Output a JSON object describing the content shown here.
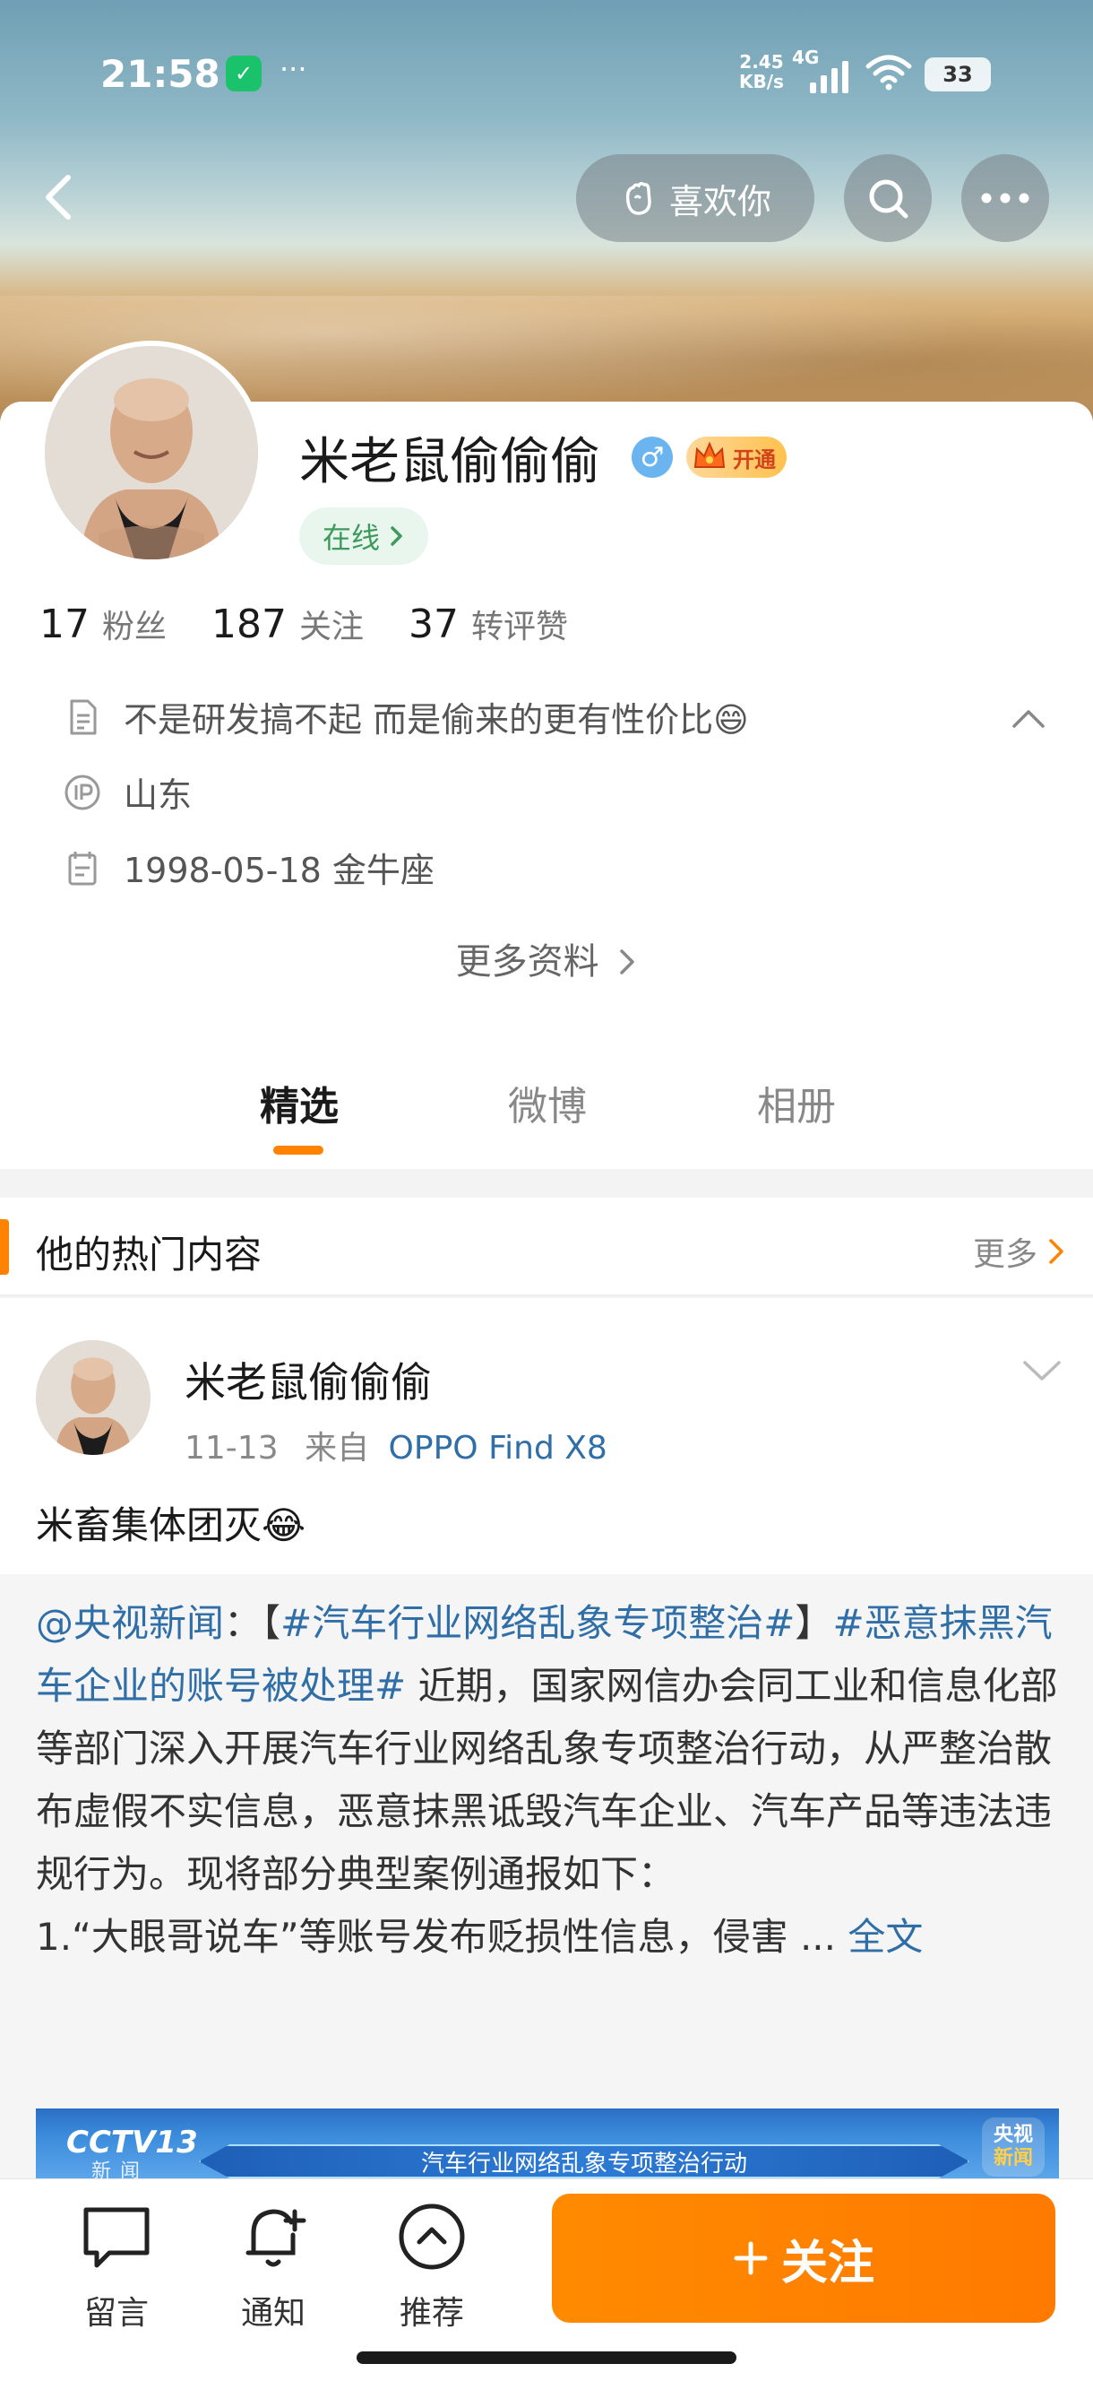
{
  "status_bar": {
    "time": "21:58",
    "app_badge": "✓",
    "dots": "···",
    "speed_value": "2.45",
    "speed_unit": "KB/s",
    "network": "4G",
    "battery": "33"
  },
  "header": {
    "like_label": "喜欢你"
  },
  "profile": {
    "name": "米老鼠偷偷偷",
    "gender_symbol": "♂",
    "vip_label": "开通",
    "online_label": "在线",
    "stats": [
      {
        "num": "17",
        "label": "粉丝"
      },
      {
        "num": "187",
        "label": "关注"
      },
      {
        "num": "37",
        "label": "转评赞"
      }
    ],
    "bio": "不是研发搞不起 而是偷来的更有性价比😄",
    "location": "山东",
    "birthday": "1998-05-18 金牛座",
    "more_info": "更多资料"
  },
  "tabs": [
    {
      "label": "精选"
    },
    {
      "label": "微博"
    },
    {
      "label": "相册"
    }
  ],
  "hot": {
    "title": "他的热门内容",
    "more": "更多"
  },
  "post": {
    "author": "米老鼠偷偷偷",
    "date": "11-13",
    "from_label": "来自",
    "source": "OPPO Find X8",
    "text": "米畜集体团灭😂",
    "repost": {
      "mention": "@央视新闻",
      "colon": "：【",
      "tag1": "#汽车行业网络乱象专项整治#",
      "bracket_close": "】",
      "tag2": "#恶意抹黑汽车企业的账号被处理#",
      "body": " 近期，国家网信办会同工业和信息化部等部门深入开展汽车行业网络乱象专项整治行动，从严整治散布虚假不实信息，恶意抹黑诋毁汽车企业、汽车产品等违法违规行为。现将部分典型案例通报如下：",
      "body2": "1.“大眼哥说车”等账号发布贬损性信息，侵害 ... ",
      "full_text": "全文",
      "image_logo": "CCTV13",
      "image_sub": "新闻",
      "image_banner": "汽车行业网络乱象专项整治行动",
      "image_corner_1": "央视",
      "image_corner_2": "新闻"
    }
  },
  "bottom_bar": {
    "items": [
      {
        "label": "留言"
      },
      {
        "label": "通知"
      },
      {
        "label": "推荐"
      }
    ],
    "follow_label": "关注"
  },
  "colors": {
    "accent": "#ff8200",
    "link": "#2f6ea6"
  }
}
